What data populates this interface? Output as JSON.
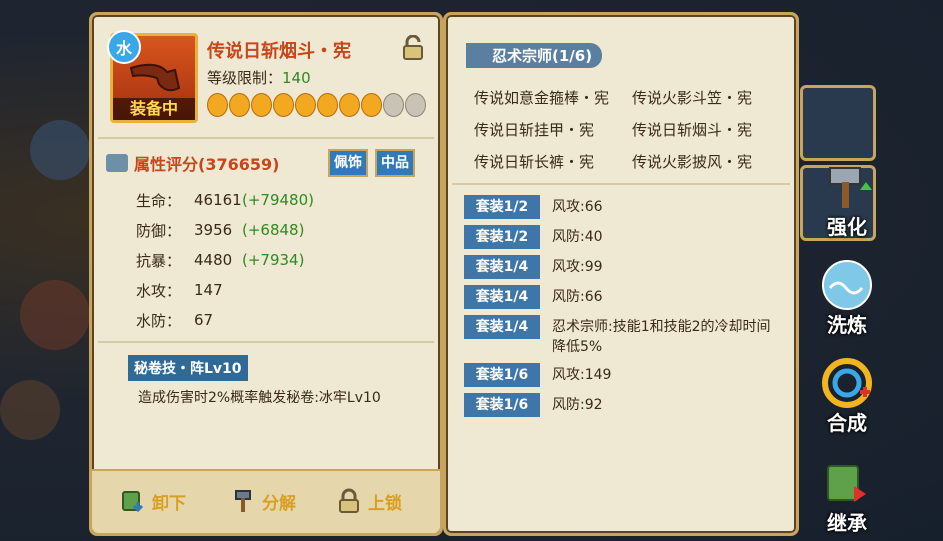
{
  "item": {
    "element_badge": "水",
    "equipped_label": "装备中",
    "title": "传说日斩烟斗・宪",
    "level_label": "等级限制：",
    "level_value": "140",
    "magatama_filled": 8,
    "magatama_total": 10
  },
  "score": {
    "label": "属性评分(376659)",
    "tag_accessory": "佩饰",
    "tag_quality": "中品"
  },
  "stats": [
    {
      "name": "生命：",
      "value": "46161",
      "bonus": "(+79480)"
    },
    {
      "name": "防御：",
      "value": "3956",
      "bonus": "(+6848)"
    },
    {
      "name": "抗暴：",
      "value": "4480",
      "bonus": "(+7934)"
    },
    {
      "name": "水攻：",
      "value": "147",
      "bonus": ""
    },
    {
      "name": "水防：",
      "value": "67",
      "bonus": ""
    }
  ],
  "skill": {
    "tag": "秘卷技・阵Lv10",
    "desc": "造成伤害时2%概率触发秘卷:冰牢Lv10"
  },
  "buttons": {
    "unequip": "卸下",
    "decompose": "分解",
    "lock": "上锁"
  },
  "suit": {
    "name": "忍术宗师(1/6)",
    "items": [
      [
        "传说如意金箍棒・宪",
        "传说火影斗笠・宪"
      ],
      [
        "传说日斩挂甲・宪",
        "传说日斩烟斗・宪"
      ],
      [
        "传说日斩长裤・宪",
        "传说火影披风・宪"
      ]
    ],
    "bonuses": [
      {
        "tag": "套装1/2",
        "text": "风攻:66"
      },
      {
        "tag": "套装1/2",
        "text": "风防:40"
      },
      {
        "tag": "套装1/4",
        "text": "风攻:99"
      },
      {
        "tag": "套装1/4",
        "text": "风防:66"
      },
      {
        "tag": "套装1/4",
        "text": "忍术宗师:技能1和技能2的冷却时间降低5%"
      },
      {
        "tag": "套装1/6",
        "text": "风攻:149"
      },
      {
        "tag": "套装1/6",
        "text": "风防:92"
      }
    ]
  },
  "side": {
    "enhance": "强化",
    "refine": "洗炼",
    "synthesize": "合成",
    "inherit": "继承"
  }
}
